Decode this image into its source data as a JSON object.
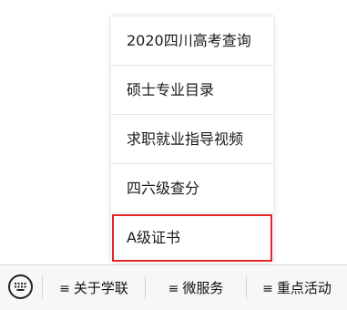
{
  "menu": {
    "items": [
      {
        "label": "2020四川高考查询"
      },
      {
        "label": "硕士专业目录"
      },
      {
        "label": "求职就业指导视频"
      },
      {
        "label": "四六级查分"
      },
      {
        "label": "A级证书",
        "highlighted": true
      }
    ]
  },
  "bottom_bar": {
    "keyboard_icon": "keyboard-icon",
    "items": [
      {
        "icon": "≡",
        "label": "关于学联"
      },
      {
        "icon": "≡",
        "label": "微服务"
      },
      {
        "icon": "≡",
        "label": "重点活动"
      }
    ]
  },
  "colors": {
    "highlight_border": "#e0262a",
    "bar_background": "#f7f7f7",
    "text": "#1a1a1a"
  }
}
